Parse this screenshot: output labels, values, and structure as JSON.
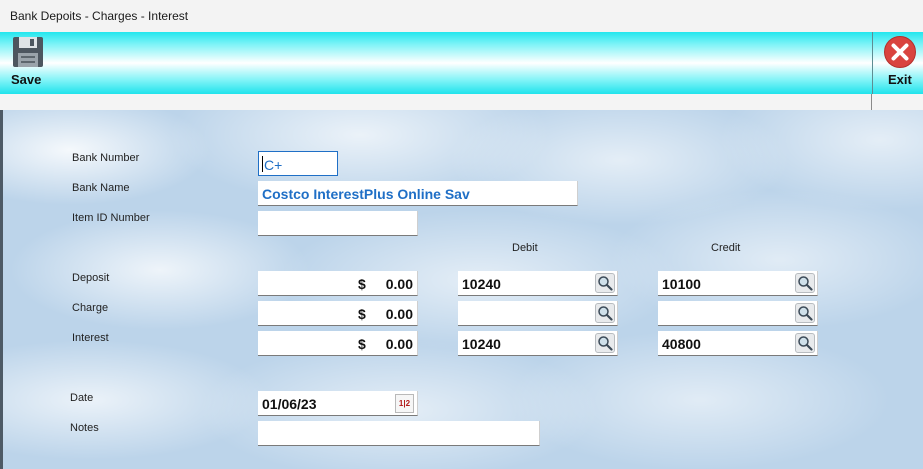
{
  "window": {
    "title": "Bank Depoits - Charges - Interest"
  },
  "toolbar": {
    "save_label": "Save",
    "save_icon": "floppy-disk-icon",
    "exit_label": "Exit",
    "exit_icon": "close-circle-icon",
    "exit_color": "#d9443f"
  },
  "form": {
    "bank_number": {
      "label": "Bank Number",
      "value": "C+"
    },
    "bank_name": {
      "label": "Bank Name",
      "value": "Costco InterestPlus Online Sav"
    },
    "item_id": {
      "label": "Item ID Number",
      "value": ""
    },
    "columns": {
      "debit": "Debit",
      "credit": "Credit"
    },
    "rows": [
      {
        "label": "Deposit",
        "currency": "$",
        "amount": "0.00",
        "debit": "10240",
        "credit": "10100"
      },
      {
        "label": "Charge",
        "currency": "$",
        "amount": "0.00",
        "debit": "",
        "credit": ""
      },
      {
        "label": "Interest",
        "currency": "$",
        "amount": "0.00",
        "debit": "10240",
        "credit": "40800"
      }
    ],
    "date": {
      "label": "Date",
      "value": "01/06/23",
      "calendar_icon": "calendar-icon",
      "calendar_glyph": "1|2"
    },
    "notes": {
      "label": "Notes",
      "value": ""
    }
  },
  "colors": {
    "toolbar_accent": "#22e6ee",
    "link_text": "#1f6fc6"
  }
}
